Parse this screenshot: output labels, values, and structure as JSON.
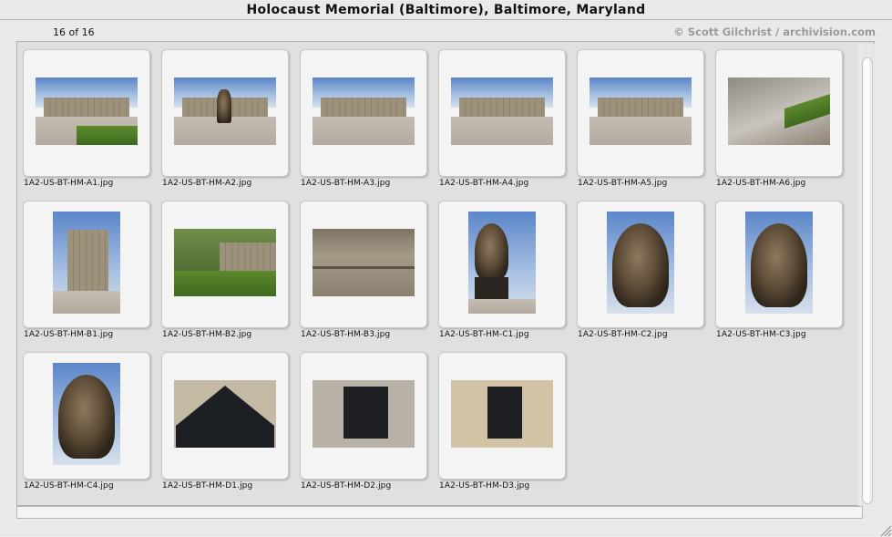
{
  "window": {
    "title": "Holocaust Memorial (Baltimore), Baltimore, Maryland"
  },
  "header": {
    "counter": "16 of 16",
    "credit": "© Scott Gilchrist / archivision.com"
  },
  "thumbnails": [
    {
      "file": "1A2-US-BT-HM-A1.jpg",
      "orientation": "landscape"
    },
    {
      "file": "1A2-US-BT-HM-A2.jpg",
      "orientation": "landscape"
    },
    {
      "file": "1A2-US-BT-HM-A3.jpg",
      "orientation": "landscape"
    },
    {
      "file": "1A2-US-BT-HM-A4.jpg",
      "orientation": "landscape"
    },
    {
      "file": "1A2-US-BT-HM-A5.jpg",
      "orientation": "landscape"
    },
    {
      "file": "1A2-US-BT-HM-A6.jpg",
      "orientation": "landscape"
    },
    {
      "file": "1A2-US-BT-HM-B1.jpg",
      "orientation": "portrait"
    },
    {
      "file": "1A2-US-BT-HM-B2.jpg",
      "orientation": "landscape"
    },
    {
      "file": "1A2-US-BT-HM-B3.jpg",
      "orientation": "landscape"
    },
    {
      "file": "1A2-US-BT-HM-C1.jpg",
      "orientation": "portrait"
    },
    {
      "file": "1A2-US-BT-HM-C2.jpg",
      "orientation": "portrait"
    },
    {
      "file": "1A2-US-BT-HM-C3.jpg",
      "orientation": "portrait"
    },
    {
      "file": "1A2-US-BT-HM-C4.jpg",
      "orientation": "portrait"
    },
    {
      "file": "1A2-US-BT-HM-D1.jpg",
      "orientation": "landscape"
    },
    {
      "file": "1A2-US-BT-HM-D2.jpg",
      "orientation": "landscape"
    },
    {
      "file": "1A2-US-BT-HM-D3.jpg",
      "orientation": "landscape"
    }
  ],
  "icons": {
    "resize": "resize-grip-icon"
  }
}
